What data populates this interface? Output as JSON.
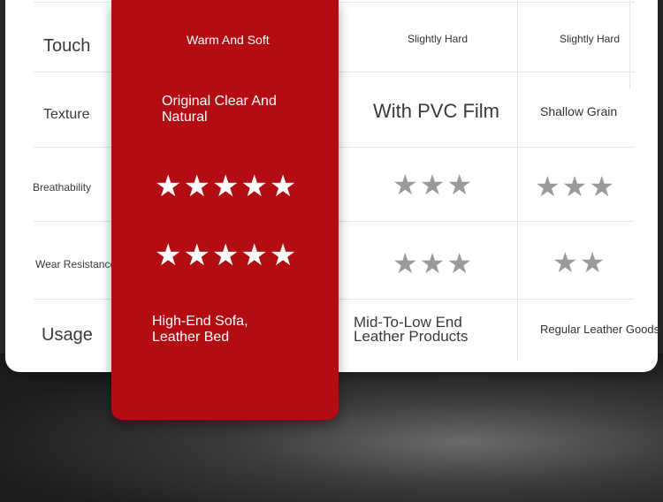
{
  "rows": {
    "touch": {
      "label": "Touch",
      "col1": "Warm And Soft",
      "col2": "Slightly Hard",
      "col3": "Slightly Hard"
    },
    "texture": {
      "label": "Texture",
      "col1": "Original Clear And Natural",
      "col2": "With PVC Film",
      "col3": "Shallow Grain"
    },
    "breathability": {
      "label": "Breathability",
      "col1_stars": "★★★★★",
      "col2_stars": "★★★",
      "col3_stars": "★★★",
      "col1_rating": 5,
      "col2_rating": 3,
      "col3_rating": 3
    },
    "wear": {
      "label": "Wear Resistance",
      "col1_stars": "★★★★★",
      "col2_stars": "★★★",
      "col3_stars": "★★",
      "col1_rating": 5,
      "col2_rating": 3,
      "col3_rating": 2
    },
    "usage": {
      "label": "Usage",
      "col1": "High-End Sofa, Leather Bed",
      "col2": "Mid-To-Low End Leather Products",
      "col3": "Regular Leather Goods"
    }
  },
  "colors": {
    "highlight_column": "#b30c12",
    "star_active": "#ffffff",
    "star_other": "#9a9a9a"
  }
}
